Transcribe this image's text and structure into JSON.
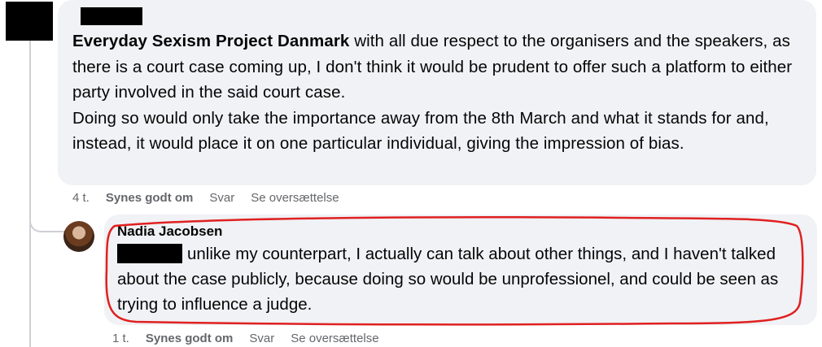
{
  "comment_1": {
    "tagged_page": "Everyday Sexism Project Danmark",
    "text_p1": " with all due respect to the organisers and the speakers, as there is a court case coming up, I don't think it would be prudent to offer such a platform to either party involved in the said court case.",
    "text_p2": "Doing so would only take the importance away from the 8th March and what it stands for and, instead, it would place it on one particular individual, giving the impression of bias.",
    "time": "4 t.",
    "like_label": "Synes godt om",
    "reply_label": "Svar",
    "translate_label": "Se oversættelse"
  },
  "comment_2": {
    "author": "Nadia Jacobsen",
    "text": "unlike my counterpart, I actually can talk about other things, and I haven't talked about the case publicly, because doing so would be unprofessionel, and could be seen as trying to influence a judge.",
    "time": "1 t.",
    "like_label": "Synes godt om",
    "reply_label": "Svar",
    "translate_label": "Se oversættelse"
  },
  "colors": {
    "bubble": "#f0f2f5",
    "meta_text": "#65676b",
    "annotation": "#e02020",
    "redaction": "#000000"
  }
}
